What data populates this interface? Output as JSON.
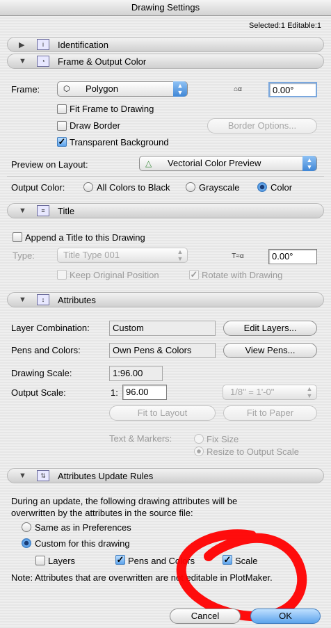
{
  "window": {
    "title": "Drawing Settings",
    "status": "Selected:1 Editable:1"
  },
  "identification": {
    "label": "Identification"
  },
  "frame_section": {
    "label": "Frame & Output Color",
    "frame_label": "Frame:",
    "frame_value": "Polygon",
    "angle_value": "0.00°",
    "fit_frame": "Fit Frame to Drawing",
    "draw_border": "Draw Border",
    "border_options": "Border Options...",
    "transparent_bg": "Transparent Background",
    "preview_label": "Preview on Layout:",
    "preview_value": "Vectorial Color Preview",
    "output_color_label": "Output Color:",
    "opt_black": "All Colors to Black",
    "opt_gray": "Grayscale",
    "opt_color": "Color"
  },
  "title_section": {
    "label": "Title",
    "append": "Append a Title to this Drawing",
    "type_label": "Type:",
    "type_value": "Title Type 001",
    "angle_value": "0.00°",
    "keep_pos": "Keep Original Position",
    "rotate": "Rotate with Drawing"
  },
  "attributes_section": {
    "label": "Attributes",
    "layer_label": "Layer Combination:",
    "layer_value": "Custom",
    "edit_layers": "Edit Layers...",
    "pens_label": "Pens and Colors:",
    "pens_value": "Own Pens & Colors",
    "view_pens": "View Pens...",
    "drawing_scale_label": "Drawing Scale:",
    "drawing_scale_value": "1:96.00",
    "output_scale_label": "Output Scale:",
    "output_prefix": "1:",
    "output_value": "96.00",
    "scale_popup": "1/8\" =  1'-0\"",
    "fit_layout": "Fit to Layout",
    "fit_paper": "Fit to Paper",
    "text_markers_label": "Text & Markers:",
    "fix_size": "Fix Size",
    "resize": "Resize to Output Scale"
  },
  "update_section": {
    "label": "Attributes Update Rules",
    "description_line1": "During an update, the following drawing attributes will be",
    "description_line2": "overwritten by the attributes in the source file:",
    "same_prefs": "Same as in Preferences",
    "custom": "Custom for this drawing",
    "layers": "Layers",
    "pens_colors": "Pens and Colors",
    "scale": "Scale",
    "note": "Note: Attributes that are overwritten are not editable in PlotMaker."
  },
  "footer": {
    "cancel": "Cancel",
    "ok": "OK"
  },
  "colors": {
    "accent": "#3f86d6",
    "annotation": "#ff0000"
  }
}
